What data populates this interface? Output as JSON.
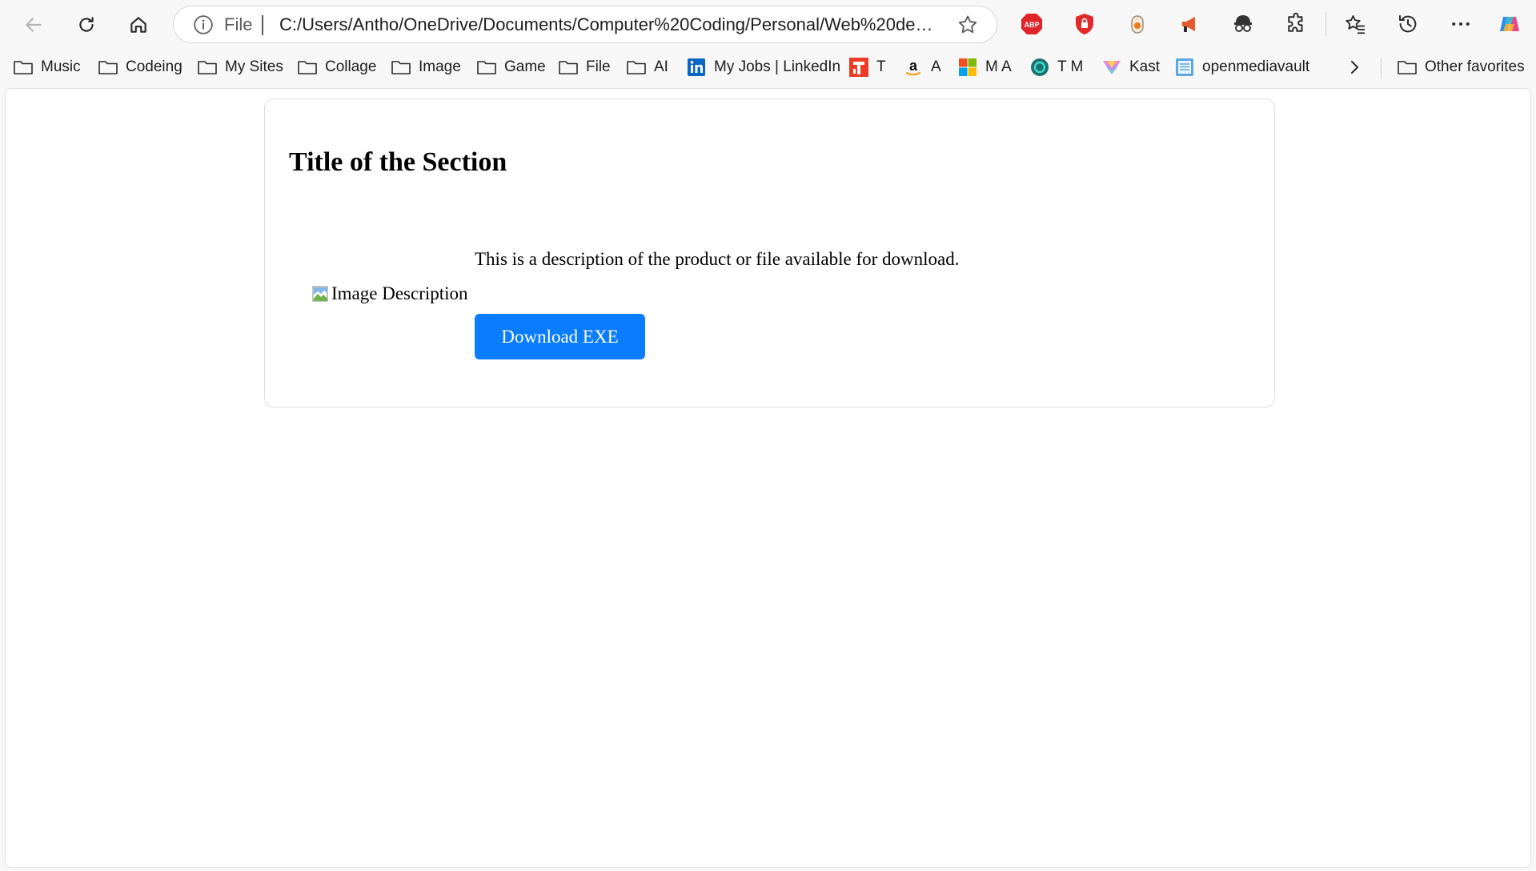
{
  "browser": {
    "address": {
      "scheme_label": "File",
      "url": "C:/Users/Antho/OneDrive/Documents/Computer%20Coding/Personal/Web%20dev/PO..."
    },
    "extensions": {
      "adblock_label": "ABP"
    },
    "favorites": [
      {
        "label": "Music",
        "icon": "folder-icon"
      },
      {
        "label": "Codeing",
        "icon": "folder-icon"
      },
      {
        "label": "My Sites",
        "icon": "folder-icon"
      },
      {
        "label": "Collage",
        "icon": "folder-icon"
      },
      {
        "label": "Image",
        "icon": "folder-icon"
      },
      {
        "label": "Game",
        "icon": "folder-icon"
      },
      {
        "label": "File",
        "icon": "folder-icon"
      },
      {
        "label": "AI",
        "icon": "folder-icon"
      },
      {
        "label": "My Jobs | LinkedIn",
        "icon": "linkedin-icon"
      },
      {
        "label": "T",
        "icon": "t-logo-icon"
      },
      {
        "label": "A",
        "icon": "amazon-icon"
      },
      {
        "label": "M A",
        "icon": "microsoft-icon"
      },
      {
        "label": "T M",
        "icon": "tm-logo-icon"
      },
      {
        "label": "Kast",
        "icon": "kast-icon"
      },
      {
        "label": "openmediavault",
        "icon": "omv-icon"
      }
    ],
    "other_favorites": "Other favorites"
  },
  "page": {
    "title": "Title of the Section",
    "description": "This is a description of the product or file available for download.",
    "image_alt": "Image Description",
    "download_label": "Download EXE"
  },
  "colors": {
    "button": "#0a7cff",
    "page_bg": "#ffffff",
    "chrome_bg": "#f7f7f7"
  }
}
